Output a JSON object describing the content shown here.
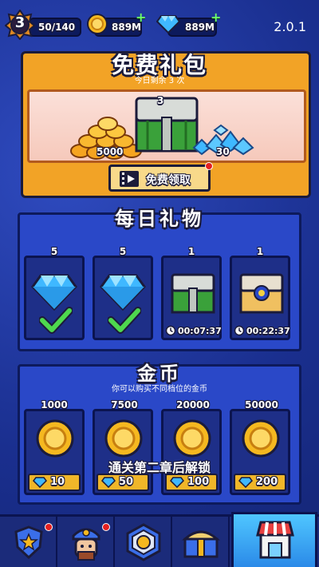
{
  "topbar": {
    "level": "3",
    "energy": "50/140",
    "coins": "889M",
    "gems": "889M",
    "version": "2.0.1"
  },
  "free_gift": {
    "title": "免费礼包",
    "subtitle": "今日剩余 3 次",
    "chest_count": "3",
    "coin_amount": "5000",
    "gem_amount": "30",
    "claim_label": "免费领取"
  },
  "daily": {
    "title": "每日礼物",
    "items": [
      {
        "count": "5",
        "icon": "gem-icon",
        "status": "claimed"
      },
      {
        "count": "5",
        "icon": "gem-icon",
        "status": "claimed"
      },
      {
        "count": "1",
        "icon": "green-chest-icon",
        "timer": "00:07:37"
      },
      {
        "count": "1",
        "icon": "gold-chest-icon",
        "timer": "00:22:37"
      }
    ]
  },
  "coins": {
    "title": "金币",
    "subtitle": "你可以购买不同档位的金币",
    "items": [
      {
        "amount": "1000",
        "price": "10"
      },
      {
        "amount": "7500",
        "price": "50"
      },
      {
        "amount": "20000",
        "price": "100"
      },
      {
        "amount": "50000",
        "price": "200"
      }
    ],
    "lock_text": "通关第二章后解锁"
  },
  "nav": {
    "tabs": [
      "badge-tab",
      "hero-tab",
      "gear-tab",
      "chest-tab",
      "shop-tab"
    ],
    "active": "shop-tab"
  },
  "colors": {
    "background": "#1a2f8f",
    "gift_panel": "#f2a326",
    "section": "#2a48c8",
    "active_tab": "#4fc6ff",
    "gem": "#3fb8ff",
    "coin": "#f5b820"
  }
}
